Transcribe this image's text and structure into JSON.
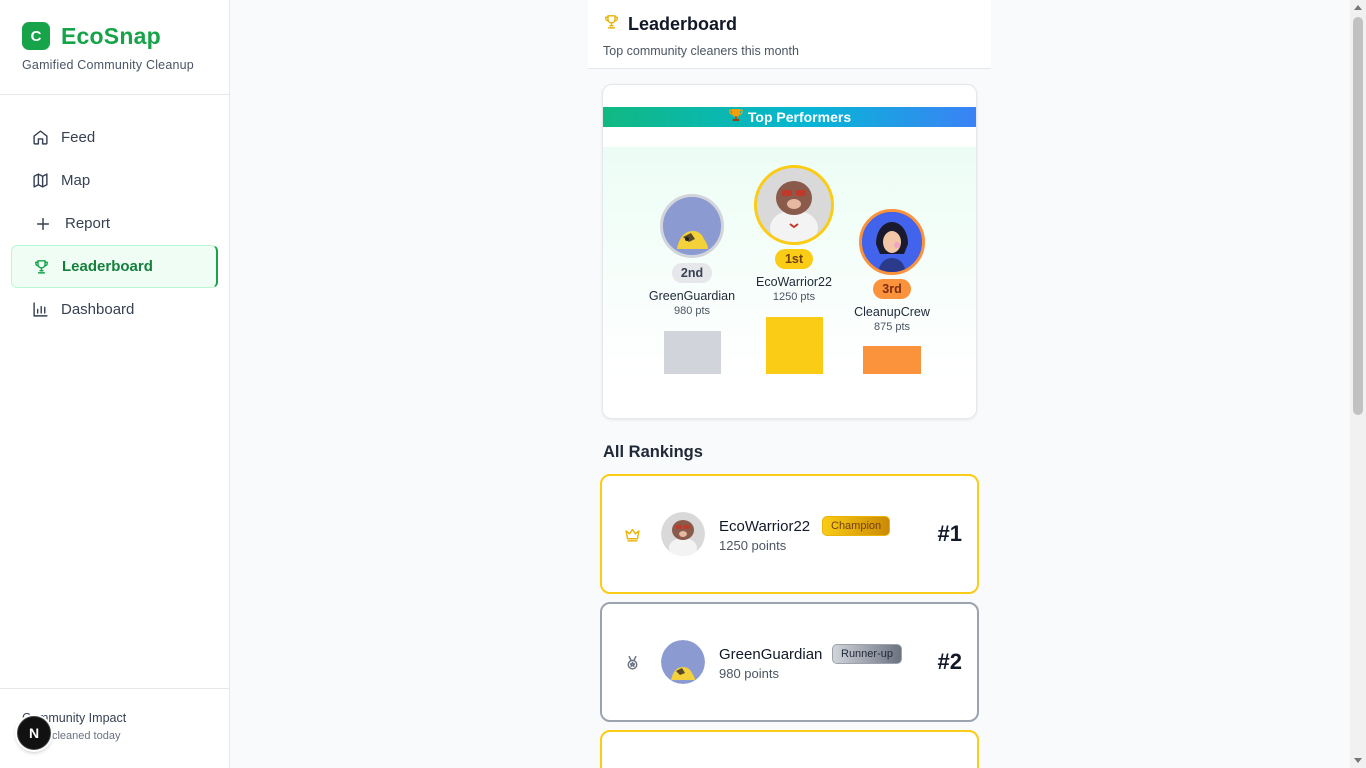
{
  "brand": {
    "logo_letter": "C",
    "name": "EcoSnap",
    "tagline": "Gamified Community Cleanup"
  },
  "nav": {
    "items": [
      {
        "label": "Feed",
        "icon": "home-icon"
      },
      {
        "label": "Map",
        "icon": "map-icon"
      },
      {
        "label": "Report",
        "icon": "plus-icon"
      },
      {
        "label": "Leaderboard",
        "icon": "trophy-icon",
        "active": true
      },
      {
        "label": "Dashboard",
        "icon": "bar-chart-icon"
      }
    ]
  },
  "impact": {
    "title": "Community Impact",
    "subtitle": "as cleaned today"
  },
  "dev_badge": {
    "letter": "N"
  },
  "header": {
    "title": "Leaderboard",
    "subtitle": "Top community cleaners this month"
  },
  "top_performers": {
    "title": "Top Performers",
    "podium": [
      {
        "place": "2nd",
        "name": "GreenGuardian",
        "points": "980 pts",
        "color": "#d1d5db"
      },
      {
        "place": "1st",
        "name": "EcoWarrior22",
        "points": "1250 pts",
        "color": "#facc15"
      },
      {
        "place": "3rd",
        "name": "CleanupCrew",
        "points": "875 pts",
        "color": "#fb923c"
      }
    ]
  },
  "rankings": {
    "title": "All Rankings",
    "rows": [
      {
        "name": "EcoWarrior22",
        "badge": "Champion",
        "points": "1250 points",
        "rank": "#1",
        "icon": "crown-icon"
      },
      {
        "name": "GreenGuardian",
        "badge": "Runner-up",
        "points": "980 points",
        "rank": "#2",
        "icon": "medal-icon"
      }
    ]
  },
  "colors": {
    "brand_green": "#16a34a",
    "gold": "#facc15",
    "silver": "#9ca3af",
    "bronze": "#fb923c"
  }
}
